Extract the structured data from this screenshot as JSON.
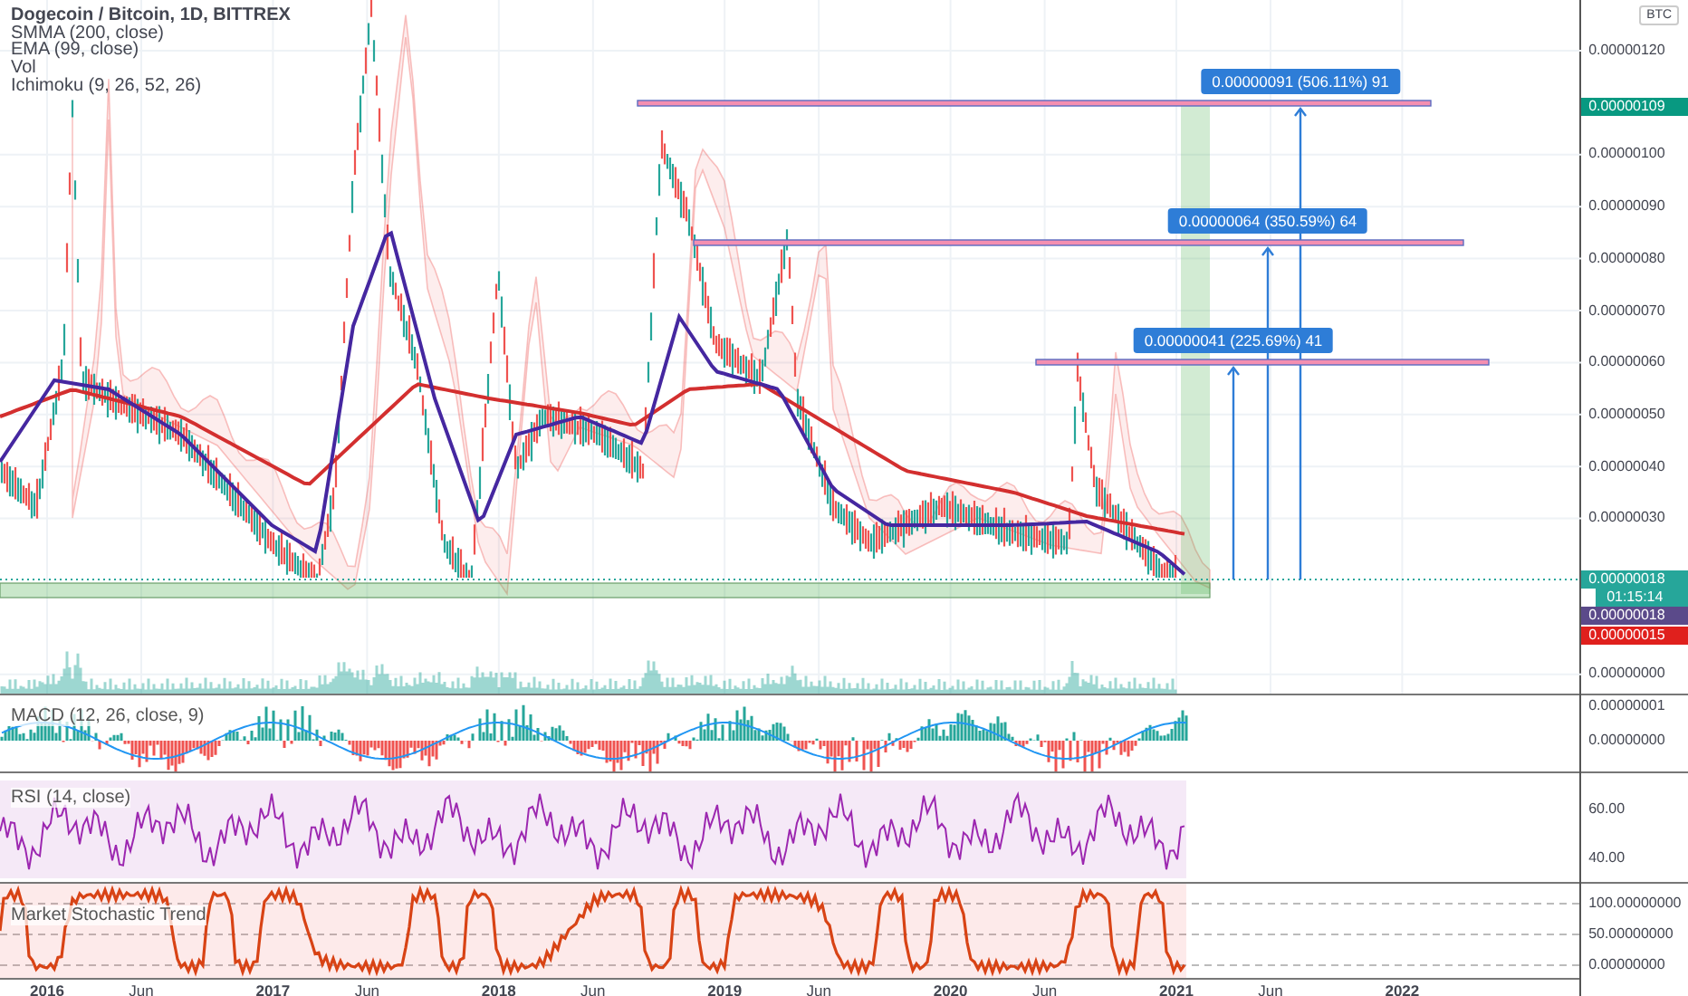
{
  "symbol": {
    "title": "Dogecoin / Bitcoin, 1D, BITTREX",
    "indicators": [
      "SMMA (200, close)",
      "EMA (99, close)",
      "Vol",
      "Ichimoku (9, 26, 52, 26)"
    ]
  },
  "currency": "BTC",
  "price_ticks": [
    "0.00000120",
    "0.00000100",
    "0.00000090",
    "0.00000080",
    "0.00000070",
    "0.00000060",
    "0.00000050",
    "0.00000040",
    "0.00000030",
    "0.00000000"
  ],
  "price_badges": [
    {
      "label": "0.00000109",
      "color": "#089981"
    },
    {
      "label": "0.00000018",
      "color": "#26a69a"
    },
    {
      "label": "01:15:14",
      "color": "#26a69a"
    },
    {
      "label": "0.00000018",
      "color": "#5b4a8a"
    },
    {
      "label": "0.00000015",
      "color": "#e0201d"
    }
  ],
  "measurements": [
    {
      "label": "0.00000091 (506.11%) 91"
    },
    {
      "label": "0.00000064 (350.59%) 64"
    },
    {
      "label": "0.00000041 (225.69%) 41"
    }
  ],
  "panes": [
    {
      "kind": "macd",
      "title": "MACD (12, 26, close, 9)",
      "ticks": [
        "0.00000001",
        "0.00000000"
      ]
    },
    {
      "kind": "rsi",
      "title": "RSI (14, close)",
      "ticks": [
        "60.00",
        "40.00"
      ]
    },
    {
      "kind": "stoch",
      "title": "Market Stochastic Trend",
      "ticks": [
        "100.00000000",
        "50.00000000",
        "0.00000000"
      ]
    }
  ],
  "time_axis": [
    "2016",
    "Jun",
    "2017",
    "Jun",
    "2018",
    "Jun",
    "2019",
    "Jun",
    "2020",
    "Jun",
    "2021",
    "Jun",
    "2022"
  ]
}
